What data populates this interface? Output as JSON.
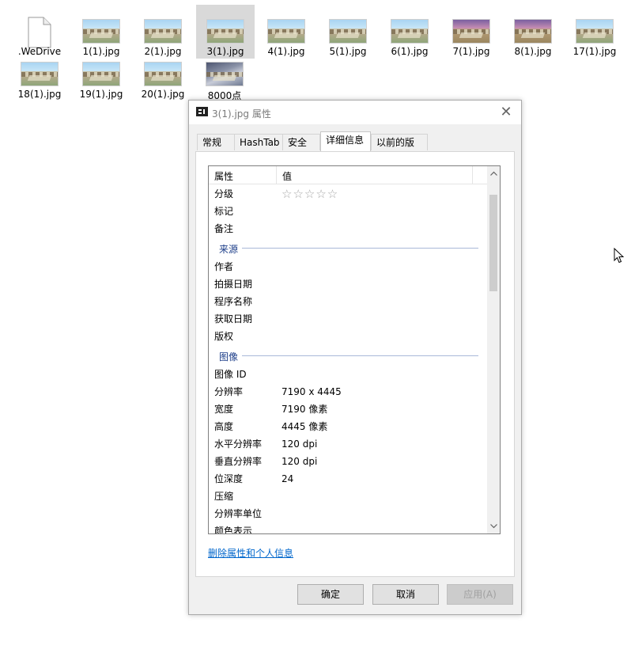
{
  "desktop": {
    "files": [
      {
        "name": ".WeDrive",
        "kind": "document"
      },
      {
        "name": "1(1).jpg",
        "kind": "image"
      },
      {
        "name": "2(1).jpg",
        "kind": "image"
      },
      {
        "name": "3(1).jpg",
        "kind": "image",
        "selected": true
      },
      {
        "name": "4(1).jpg",
        "kind": "image"
      },
      {
        "name": "5(1).jpg",
        "kind": "image"
      },
      {
        "name": "6(1).jpg",
        "kind": "image"
      },
      {
        "name": "7(1).jpg",
        "kind": "image"
      },
      {
        "name": "8(1).jpg",
        "kind": "image"
      },
      {
        "name": "17(1).jpg",
        "kind": "image"
      },
      {
        "name": "18(1).jpg",
        "kind": "image"
      },
      {
        "name": "19(1).jpg",
        "kind": "image"
      },
      {
        "name": "20(1).jpg",
        "kind": "image"
      },
      {
        "name": "8000点",
        "kind": "image"
      }
    ]
  },
  "dialog": {
    "title": "3(1).jpg 属性",
    "close_glyph": "✕",
    "tabs": [
      {
        "label": "常规"
      },
      {
        "label": "HashTab"
      },
      {
        "label": "安全"
      },
      {
        "label": "详细信息",
        "active": true
      },
      {
        "label": "以前的版本"
      }
    ],
    "list": {
      "col_property": "属性",
      "col_value": "值",
      "rating_stars": "☆☆☆☆☆",
      "rows": {
        "rating": "分级",
        "tags": "标记",
        "comments": "备注",
        "group_origin": "来源",
        "author": "作者",
        "date_taken": "拍摄日期",
        "program": "程序名称",
        "date_acquired": "获取日期",
        "copyright": "版权",
        "group_image": "图像",
        "image_id": "图像 ID",
        "dimensions": "分辨率",
        "dimensions_val": "7190 x 4445",
        "width": "宽度",
        "width_val": "7190 像素",
        "height": "高度",
        "height_val": "4445 像素",
        "h_res": "水平分辨率",
        "h_res_val": "120 dpi",
        "v_res": "垂直分辨率",
        "v_res_val": "120 dpi",
        "bit_depth": "位深度",
        "bit_depth_val": "24",
        "compression": "压缩",
        "res_unit": "分辨率单位",
        "color_rep": "颜色表示"
      }
    },
    "remove_link": "删除属性和个人信息",
    "buttons": {
      "ok": "确定",
      "cancel": "取消",
      "apply": "应用(A)"
    }
  }
}
